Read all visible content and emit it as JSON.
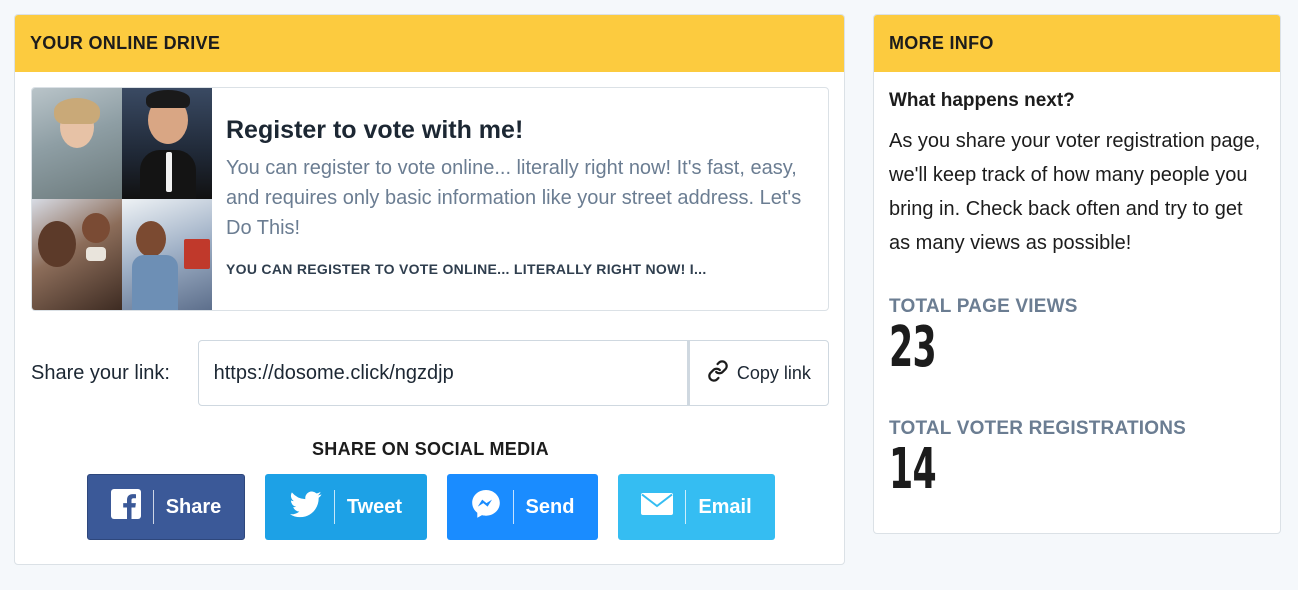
{
  "drive": {
    "header": "YOUR ONLINE DRIVE",
    "campaign": {
      "title": "Register to vote with me!",
      "description": "You can register to vote online... literally right now! It's fast, easy, and requires only basic information like your street address. Let's Do This!",
      "caps_preview": "YOU CAN REGISTER TO VOTE ONLINE... LITERALLY RIGHT NOW! I..."
    },
    "share": {
      "label": "Share your link:",
      "link_value": "https://dosome.click/ngzdjp",
      "copy_label": "Copy link"
    },
    "social": {
      "title": "SHARE ON SOCIAL MEDIA",
      "buttons": [
        {
          "label": "Share",
          "icon": "facebook-icon",
          "color": "#3b5998"
        },
        {
          "label": "Tweet",
          "icon": "twitter-icon",
          "color": "#1da1e6"
        },
        {
          "label": "Send",
          "icon": "messenger-icon",
          "color": "#1a8cff"
        },
        {
          "label": "Email",
          "icon": "envelope-icon",
          "color": "#35bdf2"
        }
      ]
    }
  },
  "info": {
    "header": "MORE INFO",
    "question": "What happens next?",
    "text": "As you share your voter registration page, we'll keep track of how many people you bring in. Check back often and try to get as many views as possible!",
    "stats": [
      {
        "label": "TOTAL PAGE VIEWS",
        "value": "23"
      },
      {
        "label": "TOTAL VOTER REGISTRATIONS",
        "value": "14"
      }
    ]
  },
  "colors": {
    "header_yellow": "#fccb3f",
    "muted_text": "#6b7d92",
    "page_bg": "#f5f8fb"
  }
}
